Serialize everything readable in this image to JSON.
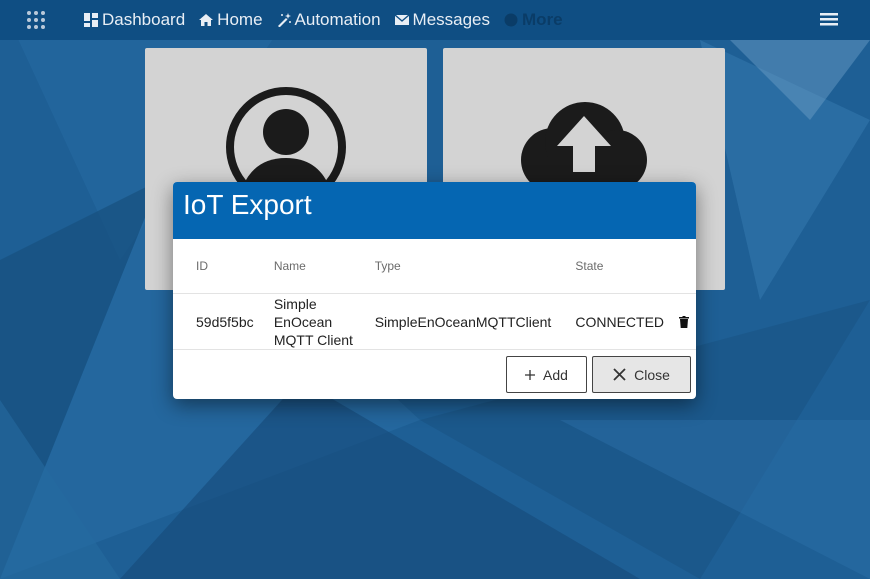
{
  "topbar": {
    "nav": [
      {
        "label": "Dashboard",
        "icon": "dashboard-icon"
      },
      {
        "label": "Home",
        "icon": "home-icon"
      },
      {
        "label": "Automation",
        "icon": "automation-wand-icon"
      },
      {
        "label": "Messages",
        "icon": "envelope-icon"
      },
      {
        "label": "More",
        "icon": "more-circle-icon"
      }
    ]
  },
  "dialog": {
    "title": "IoT Export",
    "columns": {
      "id": "ID",
      "name": "Name",
      "type": "Type",
      "state": "State"
    },
    "rows": [
      {
        "id": "59d5f5bc",
        "name_lines": [
          "Simple",
          "EnOcean",
          "MQTT Client"
        ],
        "type": "SimpleEnOceanMQTTClient",
        "state": "CONNECTED"
      }
    ],
    "add_label": "Add",
    "close_label": "Close"
  },
  "colors": {
    "topbar": "#0f4e83",
    "dialog_header": "#0566b2",
    "background": "#1d5d93",
    "tile": "#d3d3d3"
  }
}
